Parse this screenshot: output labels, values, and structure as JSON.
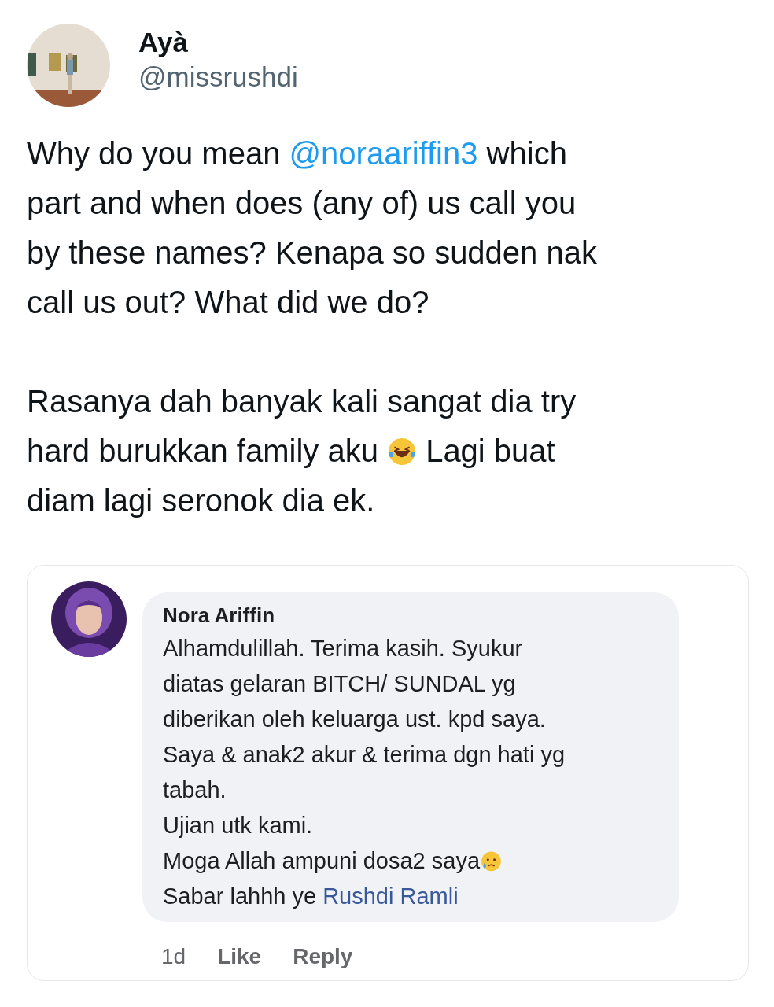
{
  "tweet": {
    "author": {
      "name": "Ayà",
      "handle": "@missrushdi"
    },
    "paragraphs": [
      {
        "lines": [
          [
            {
              "kind": "text",
              "text": "Why do you mean "
            },
            {
              "kind": "mention",
              "text": "@noraariffin3"
            },
            {
              "kind": "text",
              "text": " which"
            }
          ],
          [
            {
              "kind": "text",
              "text": "part and when does (any of) us call you"
            }
          ],
          [
            {
              "kind": "text",
              "text": "by these names? Kenapa so sudden nak"
            }
          ],
          [
            {
              "kind": "text",
              "text": "call us out? What did we do?"
            }
          ]
        ]
      },
      {
        "lines": [
          [
            {
              "kind": "text",
              "text": "Rasanya dah banyak kali sangat dia try"
            }
          ],
          [
            {
              "kind": "text",
              "text": "hard burukkan family aku "
            },
            {
              "kind": "laugh"
            },
            {
              "kind": "text",
              "text": " Lagi buat"
            }
          ],
          [
            {
              "kind": "text",
              "text": "diam lagi seronok dia ek."
            }
          ]
        ]
      }
    ]
  },
  "comment": {
    "author": "Nora Ariffin",
    "lines": [
      [
        {
          "kind": "text",
          "text": "Alhamdulillah. Terima kasih. Syukur"
        }
      ],
      [
        {
          "kind": "text",
          "text": "diatas gelaran BITCH/ SUNDAL yg"
        }
      ],
      [
        {
          "kind": "text",
          "text": "diberikan oleh keluarga ust. kpd saya."
        }
      ],
      [
        {
          "kind": "text",
          "text": "Saya & anak2 akur &  terima dgn hati yg"
        }
      ],
      [
        {
          "kind": "text",
          "text": "tabah."
        }
      ],
      [
        {
          "kind": "text",
          "text": "Ujian utk kami."
        }
      ],
      [
        {
          "kind": "text",
          "text": "Moga Allah ampuni dosa2 saya"
        },
        {
          "kind": "tear"
        }
      ],
      [
        {
          "kind": "text",
          "text": "Sabar lahhh ye "
        },
        {
          "kind": "mention",
          "text": "Rushdi Ramli"
        }
      ]
    ],
    "footer": {
      "time": "1d",
      "actions": [
        "Like",
        "Reply"
      ]
    }
  }
}
